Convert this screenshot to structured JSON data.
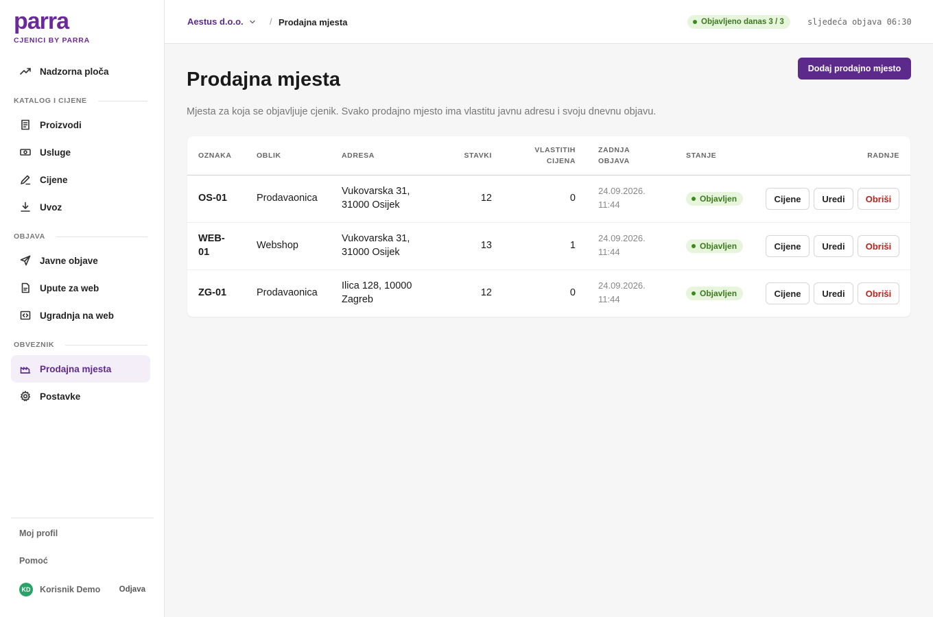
{
  "sidebar": {
    "logo": "parra",
    "logo_sub": "CJENICI BY PARRA",
    "dashboard": "Nadzorna ploča",
    "sections": {
      "catalog": "KATALOG I CIJENE",
      "publish": "OBJAVA",
      "obligee": "OBVEZNIK"
    },
    "items": {
      "products": "Proizvodi",
      "services": "Usluge",
      "prices": "Cijene",
      "import": "Uvoz",
      "public": "Javne objave",
      "web_guide": "Upute za web",
      "embed": "Ugradnja na web",
      "locations": "Prodajna mjesta",
      "settings": "Postavke"
    },
    "footer": {
      "profile": "Moj profil",
      "help": "Pomoć",
      "user_initials": "KD",
      "user_name": "Korisnik Demo",
      "logout": "Odjava"
    }
  },
  "topbar": {
    "company": "Aestus d.o.o.",
    "separator": "/",
    "current": "Prodajna mjesta",
    "published_badge": "Objavljeno danas 3 / 3",
    "next_publish": "sljedeća objava 06:30"
  },
  "main": {
    "title": "Prodajna mjesta",
    "add_button": "Dodaj prodajno mjesto",
    "description": "Mjesta za koja se objavljuje cjenik. Svako prodajno mjesto ima vlastitu javnu adresu i svoju dnevnu objavu.",
    "columns": {
      "code": "OZNAKA",
      "form": "OBLIK",
      "address": "ADRESA",
      "items": "STAVKI",
      "own_prices": "VLASTITIH CIJENA",
      "last_publish": "ZADNJA OBJAVA",
      "state": "STANJE",
      "actions": "RADNJE"
    },
    "actions": {
      "prices": "Cijene",
      "edit": "Uredi",
      "delete": "Obriši"
    },
    "rows": [
      {
        "code": "OS-01",
        "form": "Prodavaonica",
        "address": "Vukovarska 31, 31000 Osijek",
        "items": "12",
        "own_prices": "0",
        "last_publish": "24.09.2026. 11:44",
        "state": "Objavljen"
      },
      {
        "code": "WEB-01",
        "form": "Webshop",
        "address": "Vukovarska 31, 31000 Osijek",
        "items": "13",
        "own_prices": "1",
        "last_publish": "24.09.2026. 11:44",
        "state": "Objavljen"
      },
      {
        "code": "ZG-01",
        "form": "Prodavaonica",
        "address": "Ilica 128, 10000 Zagreb",
        "items": "12",
        "own_prices": "0",
        "last_publish": "24.09.2026. 11:44",
        "state": "Objavljen"
      }
    ]
  }
}
